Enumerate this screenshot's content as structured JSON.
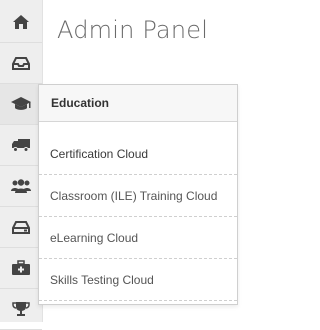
{
  "page": {
    "title": "Admin Panel"
  },
  "sidebar": {
    "items": [
      {
        "icon": "home-icon"
      },
      {
        "icon": "inbox-icon"
      },
      {
        "icon": "graduation-cap-icon",
        "active": true
      },
      {
        "icon": "truck-icon"
      },
      {
        "icon": "users-icon"
      },
      {
        "icon": "hard-drive-icon"
      },
      {
        "icon": "medkit-icon"
      },
      {
        "icon": "trophy-icon"
      }
    ]
  },
  "flyout": {
    "heading": "Education",
    "items": [
      {
        "label": "Certification Cloud"
      },
      {
        "label": "Classroom (ILE) Training Cloud"
      },
      {
        "label": "eLearning Cloud"
      },
      {
        "label": "Skills Testing Cloud"
      }
    ]
  },
  "colors": {
    "sidebar_bg": "#eeeeee",
    "icon": "#444444",
    "title": "#6a6a6a",
    "flyout_border": "#cfcfcf"
  }
}
